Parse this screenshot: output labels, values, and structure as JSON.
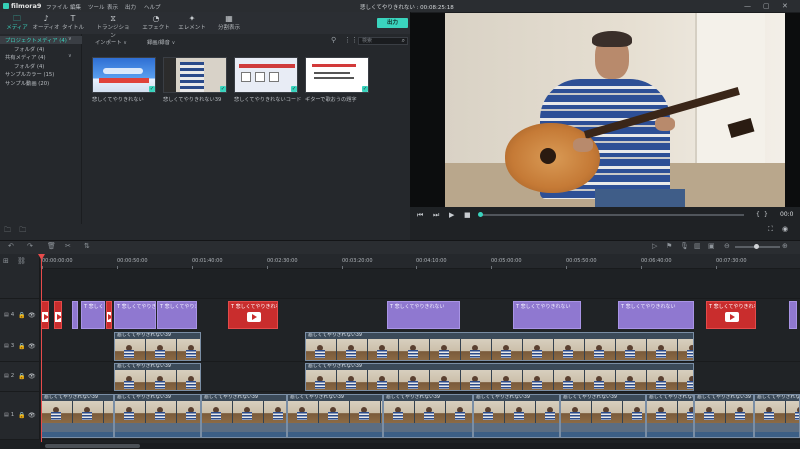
{
  "app": {
    "name": "filmora9"
  },
  "menu": [
    "ファイル",
    "編集",
    "ツール",
    "表示",
    "出力",
    "ヘルプ"
  ],
  "title": "悲しくてやりきれない : 00:08:25:18",
  "tabs": [
    {
      "label": "メディア",
      "icon": "folder-icon",
      "active": true
    },
    {
      "label": "オーディオ",
      "icon": "music-note-icon",
      "active": false
    },
    {
      "label": "タイトル",
      "icon": "title-t-icon",
      "active": false
    },
    {
      "label": "トランジション",
      "icon": "transition-icon",
      "active": false
    },
    {
      "label": "エフェクト",
      "icon": "effect-icon",
      "active": false
    },
    {
      "label": "エレメント",
      "icon": "element-icon",
      "active": false
    },
    {
      "label": "分割表示",
      "icon": "split-screen-icon",
      "active": false
    }
  ],
  "export_label": "出力",
  "tree": [
    {
      "label": "プロジェクトメディア (4)",
      "selected": true,
      "indent": 0,
      "chev": "∨"
    },
    {
      "label": "フォルダ (4)",
      "selected": false,
      "indent": 1,
      "chev": ""
    },
    {
      "label": "共有メディア (4)",
      "selected": false,
      "indent": 0,
      "chev": "∨"
    },
    {
      "label": "フォルダ (4)",
      "selected": false,
      "indent": 1,
      "chev": ""
    },
    {
      "label": "サンプルカラー (15)",
      "selected": false,
      "indent": 0,
      "chev": ""
    },
    {
      "label": "サンプル動画 (20)",
      "selected": false,
      "indent": 0,
      "chev": ""
    }
  ],
  "library": {
    "import_label": "インポート",
    "record_label": "録画/録音",
    "search_placeholder": "検索",
    "items": [
      {
        "label": "悲しくてやりきれない",
        "kind": "sky"
      },
      {
        "label": "悲しくてやりきれない39",
        "kind": "person"
      },
      {
        "label": "悲しくてやりきれないコード",
        "kind": "chords"
      },
      {
        "label": "ギターで歌おうの題字",
        "kind": "text"
      }
    ]
  },
  "preview": {
    "timecode": "00:0"
  },
  "ruler": [
    "00:00:00:00",
    "00:00:50:00",
    "00:01:40:00",
    "00:02:30:00",
    "00:03:20:00",
    "00:04:10:00",
    "00:05:00:00",
    "00:05:50:00",
    "00:06:40:00",
    "00:07:30:00"
  ],
  "tracks": [
    {
      "label": "4"
    },
    {
      "label": "3"
    },
    {
      "label": "2"
    },
    {
      "label": "1"
    }
  ],
  "clips": {
    "text_title": "T 悲しくてやりきれない",
    "red_title": "T 悲しくてやりきれない",
    "video_title": "悲しくてやりきれない39"
  }
}
